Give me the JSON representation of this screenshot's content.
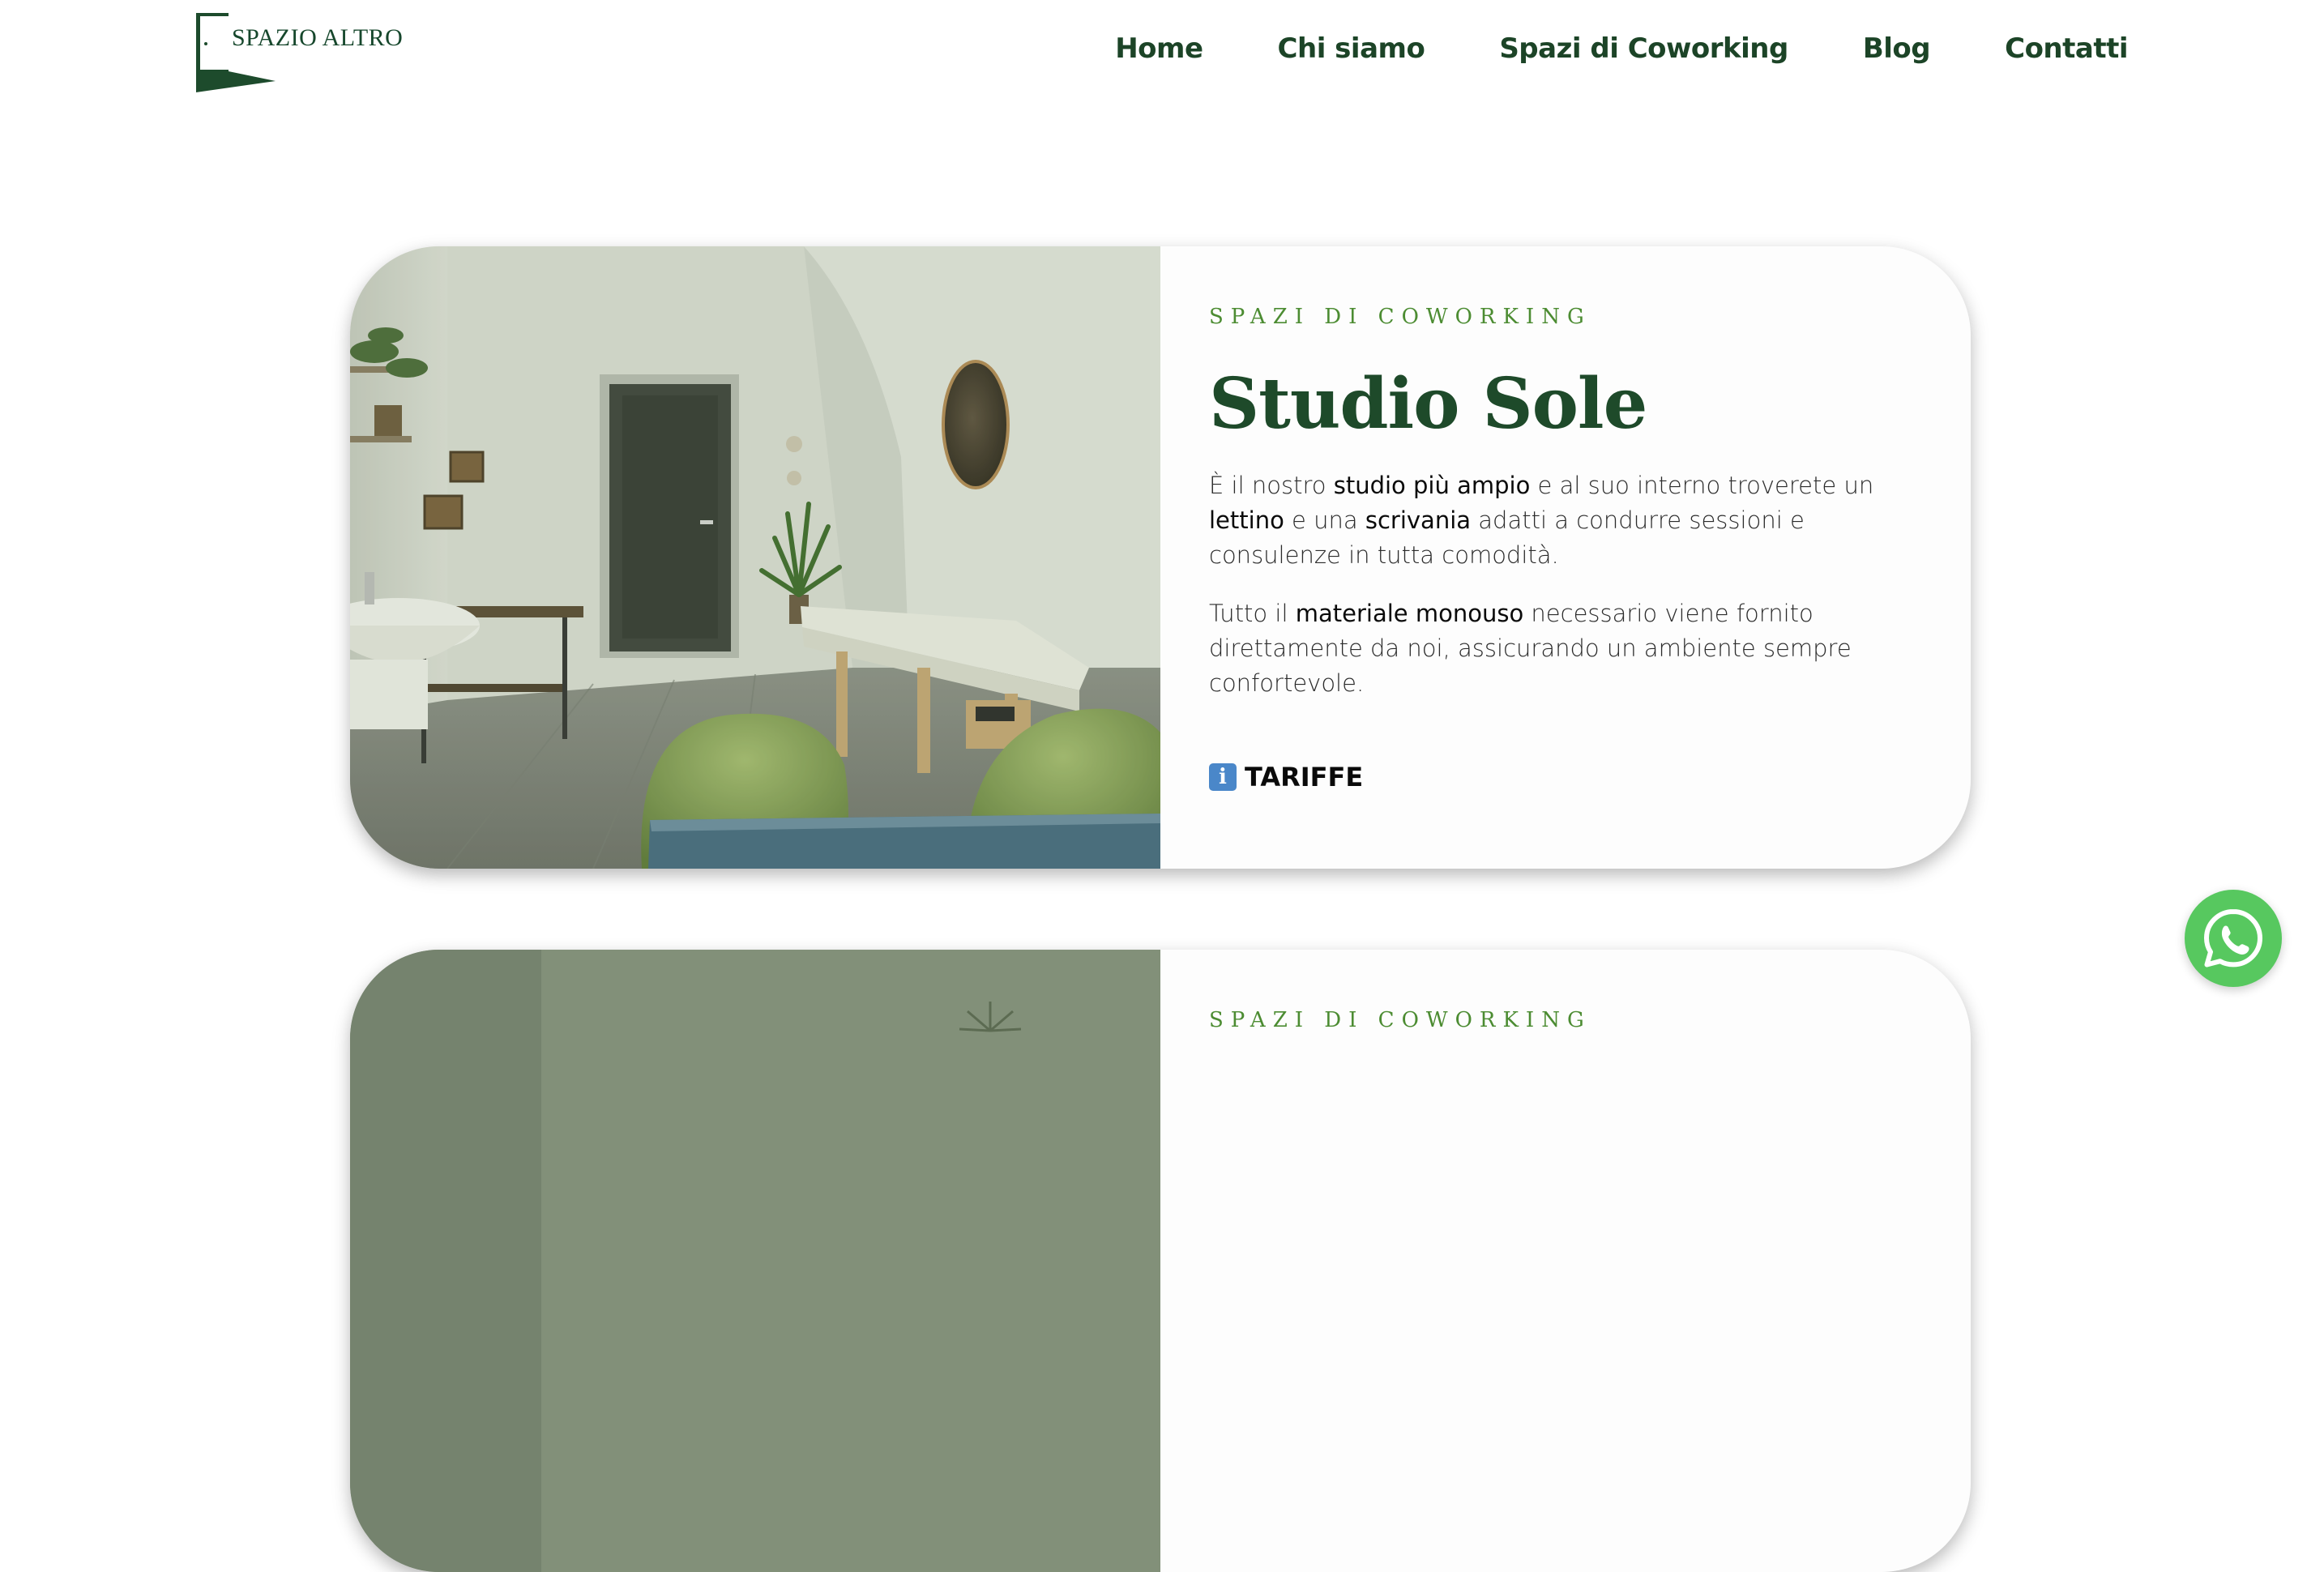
{
  "brand": {
    "logo_text": "SPAZIO ALTRO",
    "primary_color": "#1e4a2a",
    "accent_color": "#4c8c32"
  },
  "nav": {
    "items": [
      {
        "label": "Home"
      },
      {
        "label": "Chi siamo"
      },
      {
        "label": "Spazi di Coworking"
      },
      {
        "label": "Blog"
      },
      {
        "label": "Contatti"
      }
    ]
  },
  "cards": [
    {
      "eyebrow": "SPAZI DI COWORKING",
      "title": "Studio Sole",
      "paragraph1": {
        "t1": "È il nostro ",
        "b1": "studio più ampio",
        "t2": " e al suo interno troverete un ",
        "b2": "lettino",
        "t3": " e una ",
        "b3": "scrivania",
        "t4": " adatti a condurre sessioni e consulenze in tutta comodità."
      },
      "paragraph2": {
        "t1": "Tutto il ",
        "b1": "materiale monouso",
        "t2": " necessario viene fornito direttamente da noi, assicurando un ambiente sempre confortevole."
      },
      "cta": {
        "icon": "info-icon",
        "glyph": "i",
        "label": "TARIFFE"
      }
    },
    {
      "eyebrow": "SPAZI DI COWORKING"
    }
  ],
  "whatsapp": {
    "icon": "whatsapp-icon",
    "color": "#57c85f"
  }
}
